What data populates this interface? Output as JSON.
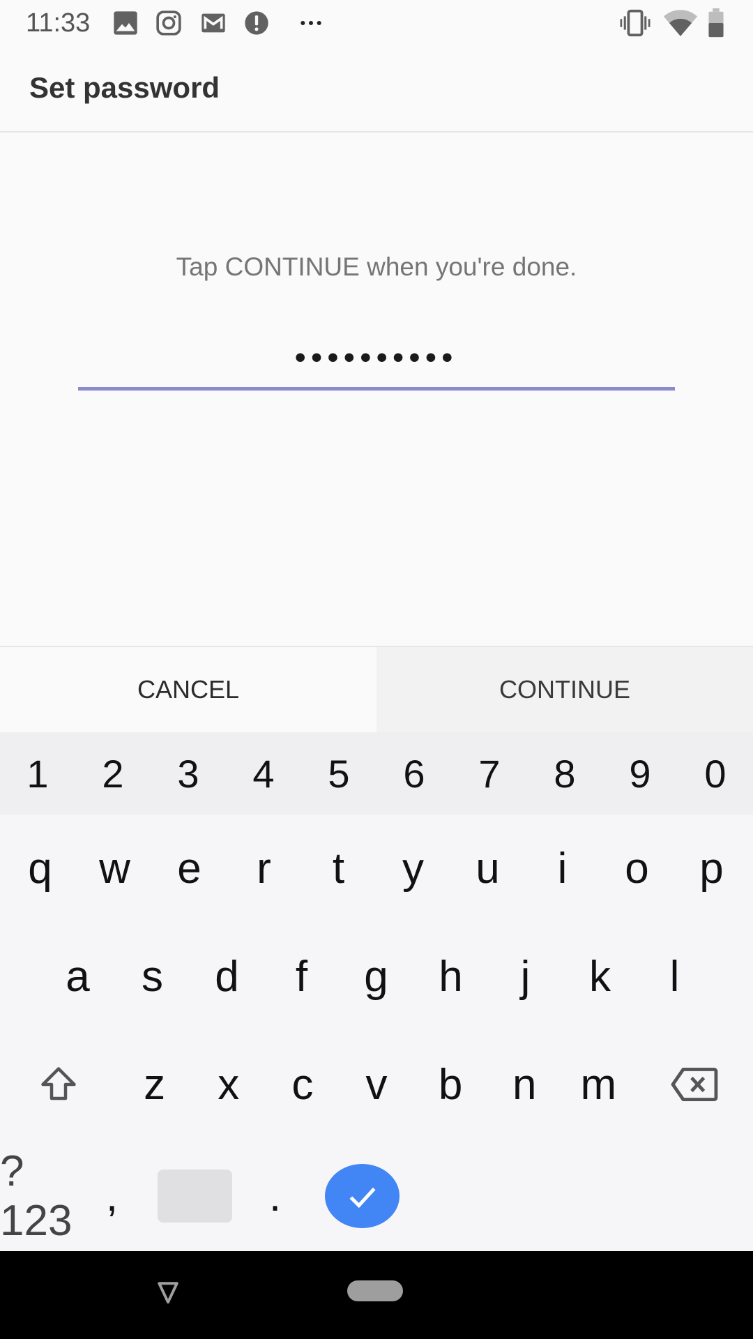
{
  "status_bar": {
    "time": "11:33",
    "left_icons": [
      "image-icon",
      "instagram-icon",
      "gmail-icon",
      "alert-icon",
      "more-notifications-icon"
    ],
    "right_icons": [
      "vibrate-icon",
      "wifi-icon",
      "battery-icon"
    ]
  },
  "app_bar": {
    "title": "Set password"
  },
  "content": {
    "hint": "Tap CONTINUE when you're done.",
    "password_field": {
      "value": "••••••••••",
      "masked_length": 10,
      "focused": true,
      "underline_color": "#8a8bcb"
    }
  },
  "actions": {
    "cancel_label": "CANCEL",
    "continue_label": "CONTINUE"
  },
  "keyboard": {
    "number_row": [
      "1",
      "2",
      "3",
      "4",
      "5",
      "6",
      "7",
      "8",
      "9",
      "0"
    ],
    "row1": [
      "q",
      "w",
      "e",
      "r",
      "t",
      "y",
      "u",
      "i",
      "o",
      "p"
    ],
    "row2": [
      "a",
      "s",
      "d",
      "f",
      "g",
      "h",
      "j",
      "k",
      "l"
    ],
    "row3": [
      "z",
      "x",
      "c",
      "v",
      "b",
      "n",
      "m"
    ],
    "symbols_label": "?123",
    "comma": ",",
    "period": ".",
    "enter_color": "#4285f4"
  },
  "nav_bar": {
    "icons": [
      "back-icon",
      "home-icon"
    ]
  }
}
